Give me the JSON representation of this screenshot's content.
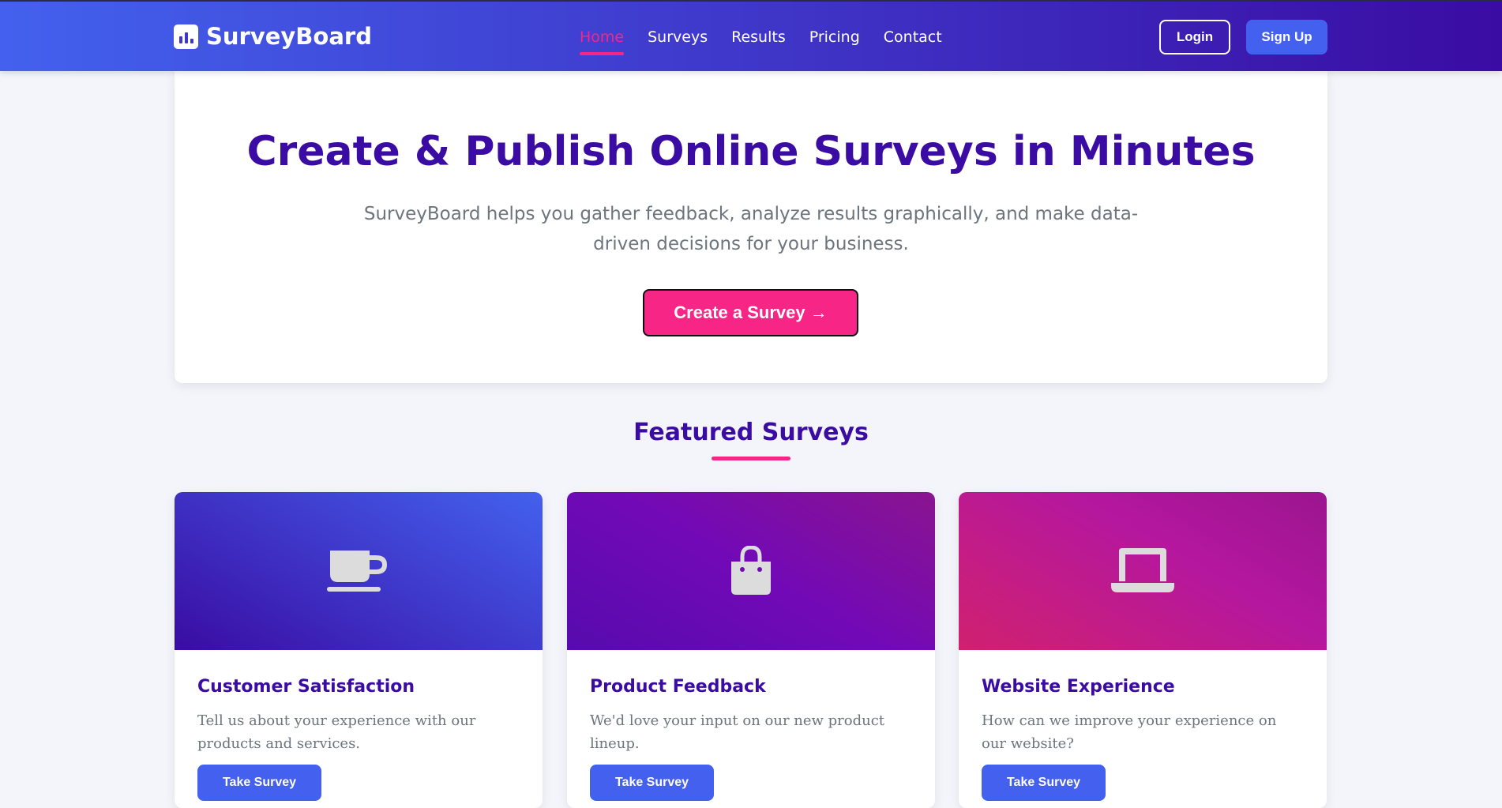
{
  "brand": {
    "name": "SurveyBoard"
  },
  "nav": {
    "items": [
      {
        "label": "Home",
        "active": true
      },
      {
        "label": "Surveys"
      },
      {
        "label": "Results"
      },
      {
        "label": "Pricing"
      },
      {
        "label": "Contact"
      }
    ],
    "login_label": "Login",
    "signup_label": "Sign Up"
  },
  "hero": {
    "title": "Create & Publish Online Surveys in Minutes",
    "subtitle": "SurveyBoard helps you gather feedback, analyze results graphically, and make data-driven decisions for your business.",
    "cta_label": "Create a Survey →"
  },
  "featured": {
    "title": "Featured Surveys",
    "cards": [
      {
        "icon": "coffee-cup-icon",
        "title": "Customer Satisfaction",
        "description": "Tell us about your experience with our products and services.",
        "button_label": "Take Survey"
      },
      {
        "icon": "shopping-bag-icon",
        "title": "Product Feedback",
        "description": "We'd love your input on our new product lineup.",
        "button_label": "Take Survey"
      },
      {
        "icon": "laptop-icon",
        "title": "Website Experience",
        "description": "How can we improve your experience on our website?",
        "button_label": "Take Survey"
      }
    ]
  },
  "colors": {
    "primary": "#4361ee",
    "secondary": "#3a0ca3",
    "accent": "#f72585",
    "text_muted": "#6c757d"
  }
}
